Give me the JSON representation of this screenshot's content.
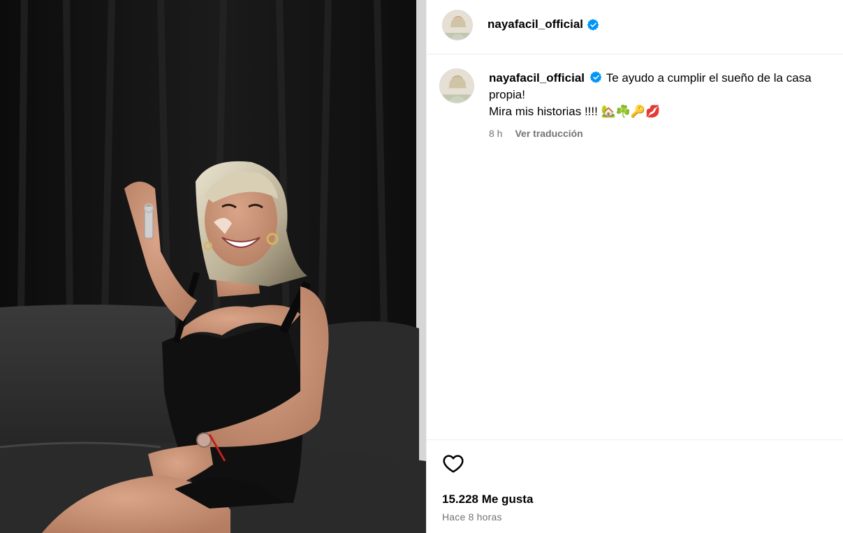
{
  "post": {
    "username": "nayafacil_official",
    "verified": true,
    "caption_text": "Te ayudo a cumplir el sueño de la casa propia!",
    "caption_line2": "Mira mis historias !!!!",
    "caption_emojis": "🏡☘️🔑💋",
    "relative_time": "8 h",
    "translate_label": "Ver traducción",
    "likes_label": "15.228 Me gusta",
    "posted_ago": "Hace 8 horas"
  },
  "icons": {
    "verified": "verified-badge-icon",
    "like": "heart-outline-icon"
  },
  "colors": {
    "verified_blue": "#0095f6",
    "secondary_text": "#737373",
    "divider": "#efefef"
  }
}
